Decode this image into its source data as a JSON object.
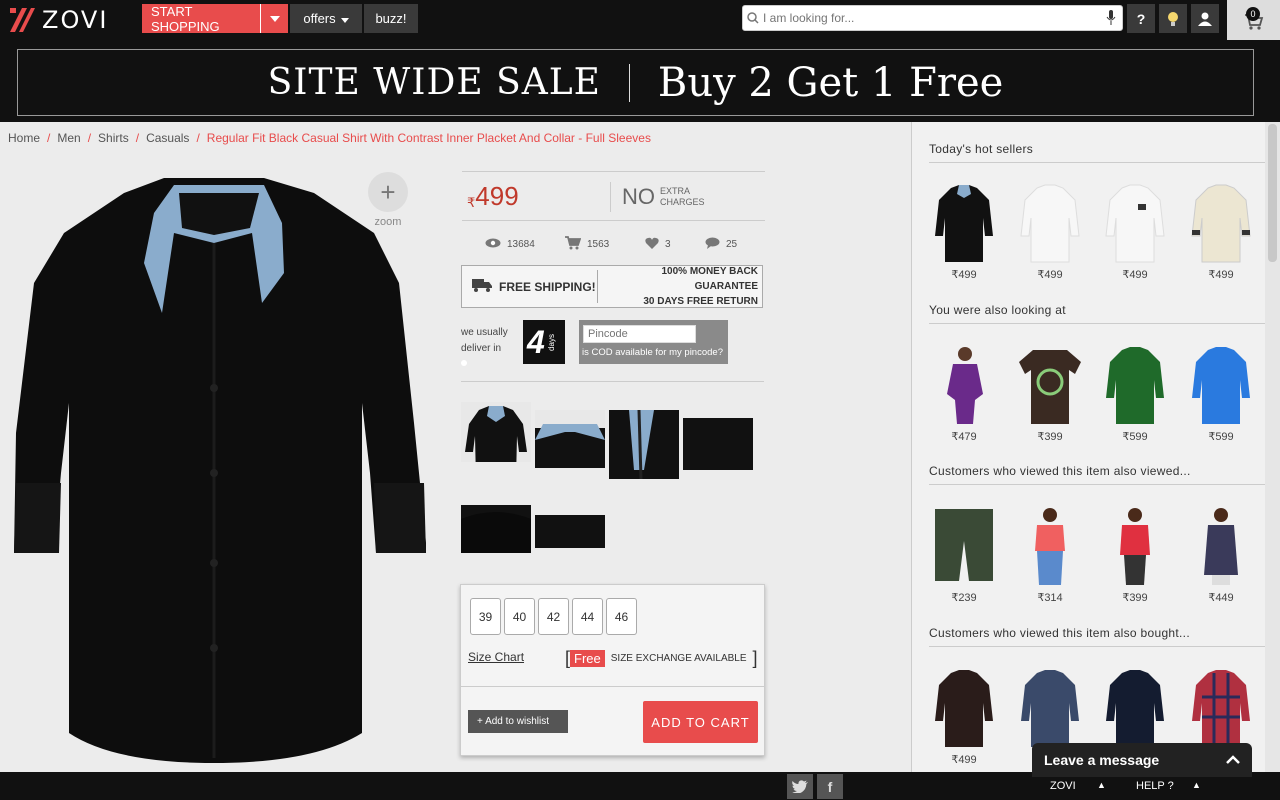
{
  "brand": {
    "name": "ZOVI"
  },
  "topnav": {
    "start_shopping": "START SHOPPING",
    "offers": "offers",
    "buzz": "buzz!",
    "search_placeholder": "I am looking for...",
    "cart_count": "0"
  },
  "banner": {
    "left": "SITE WIDE SALE",
    "right": "Buy 2 Get 1 Free"
  },
  "breadcrumb": {
    "items": [
      "Home",
      "Men",
      "Shirts",
      "Casuals"
    ],
    "separator": "/",
    "current": "Regular Fit Black Casual Shirt With Contrast Inner Placket And Collar - Full Sleeves"
  },
  "product": {
    "zoom_label": "zoom",
    "currency": "₹",
    "price": "499",
    "no": "NO",
    "extra": "EXTRA",
    "charges": "CHARGES",
    "stats": {
      "views": "13684",
      "carts": "1563",
      "likes": "3",
      "comments": "25"
    },
    "free_shipping": "FREE SHIPPING!",
    "guarantee_1": "100% MONEY BACK GUARANTEE",
    "guarantee_2": "30 DAYS FREE RETURN",
    "deliver_1": "we usually",
    "deliver_2": "deliver in",
    "days_num": "4",
    "days_word": "days",
    "pincode_placeholder": "Pincode",
    "cod_text": "is COD available for my pincode?",
    "sizes": [
      "39",
      "40",
      "42",
      "44",
      "46"
    ],
    "size_chart": "Size Chart",
    "free": "Free",
    "size_exchange": "SIZE EXCHANGE AVAILABLE",
    "wishlist": "+ Add to wishlist",
    "add_to_cart": "ADD TO CART"
  },
  "sidebar": {
    "sections": [
      {
        "title": "Today's hot sellers",
        "prices": [
          "499",
          "499",
          "499",
          "499"
        ]
      },
      {
        "title": "You were also looking at",
        "prices": [
          "479",
          "399",
          "599",
          "599"
        ]
      },
      {
        "title": "Customers who viewed this item also viewed...",
        "prices": [
          "239",
          "314",
          "399",
          "449"
        ]
      },
      {
        "title": "Customers who viewed this item also bought...",
        "prices": [
          "499",
          "",
          "",
          ""
        ]
      }
    ],
    "currency": "₹"
  },
  "footer": {
    "twitter": "twitter-icon",
    "facebook": "f",
    "zovi": "ZOVI",
    "help": "HELP ?",
    "chat": "Leave a message"
  },
  "colors": {
    "accent": "#e84c4c",
    "dark": "#111111"
  }
}
